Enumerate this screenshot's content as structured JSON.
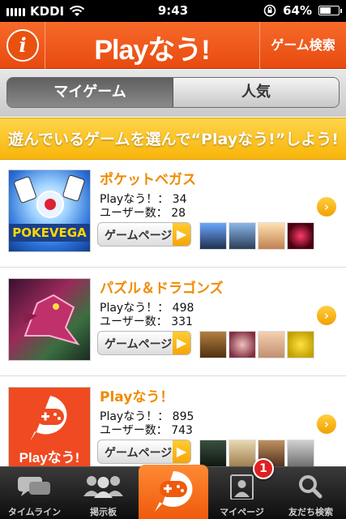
{
  "status_bar": {
    "carrier": "KDDI",
    "time": "9:43",
    "battery": "64%",
    "battery_level": 0.64
  },
  "header": {
    "logo": "Playなう!",
    "info_label": "i",
    "search_label": "ゲーム検索"
  },
  "segment": {
    "tabs": [
      {
        "label": "マイゲーム",
        "active": true
      },
      {
        "label": "人気",
        "active": false
      }
    ]
  },
  "banner": {
    "text": "遊んでいるゲームを選んで“Playなう!”しよう!"
  },
  "games": [
    {
      "title": "ポケットベガス",
      "now_label": "Playなう！：",
      "now_count": "34",
      "users_label": "ユーザー数：",
      "users_count": "28",
      "button_label": "ゲームページ",
      "thumb_text": "POKEVEGA"
    },
    {
      "title": "パズル＆ドラゴンズ",
      "now_label": "Playなう！：",
      "now_count": "498",
      "users_label": "ユーザー数：",
      "users_count": "331",
      "button_label": "ゲームページ",
      "thumb_text": ""
    },
    {
      "title": "Playなう！",
      "now_label": "Playなう！：",
      "now_count": "895",
      "users_label": "ユーザー数：",
      "users_count": "743",
      "button_label": "ゲームページ",
      "thumb_text": "Playなう!"
    }
  ],
  "tabbar": {
    "items": [
      {
        "label": "タイムライン",
        "icon": "chat-bubbles-icon"
      },
      {
        "label": "掲示板",
        "icon": "people-icon"
      },
      {
        "label": "",
        "icon": "playnow-gamepad-icon"
      },
      {
        "label": "マイページ",
        "icon": "profile-card-icon"
      },
      {
        "label": "友だち検索",
        "icon": "magnifier-icon"
      }
    ],
    "badge": "1"
  },
  "colors": {
    "accent": "#ef5a0c",
    "banner": "#f8b50a",
    "title": "#f08a00"
  }
}
